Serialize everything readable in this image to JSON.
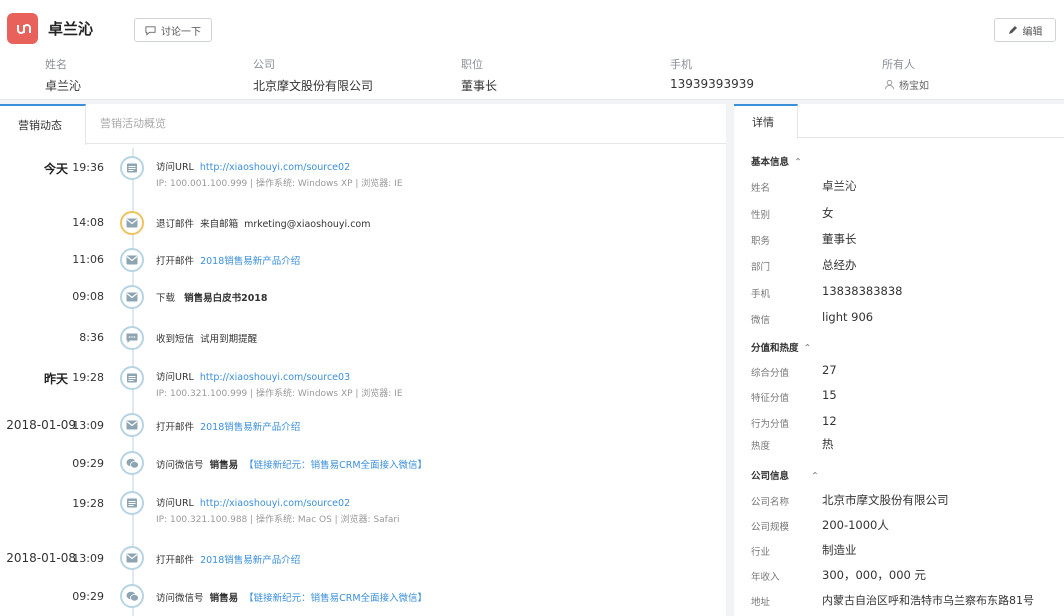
{
  "header": {
    "name": "卓兰沁",
    "discuss_label": "讨论一下",
    "edit_label": "编辑",
    "fields": [
      {
        "label": "姓名",
        "value": "卓兰沁"
      },
      {
        "label": "公司",
        "value": "北京摩文股份有限公司"
      },
      {
        "label": "职位",
        "value": "董事长"
      },
      {
        "label": "手机",
        "value": "13939393939"
      },
      {
        "label": "所有人",
        "value": "杨宝如"
      }
    ]
  },
  "tabs": {
    "active": "营销动态",
    "inactive": "营销活动概览"
  },
  "timeline": [
    {
      "date": "今天",
      "time": "19:36",
      "icon": "web-page-icon",
      "action": "访问URL",
      "link": "http://xiaoshouyi.com/source02",
      "detail": "IP: 100.001.100.999 | 操作系统: Windows XP | 浏览器: IE"
    },
    {
      "date": "",
      "time": "14:08",
      "icon": "mail-icon",
      "action": "退订邮件",
      "extra": "来自邮箱",
      "text": "mrketing@xiaoshouyi.com"
    },
    {
      "date": "",
      "time": "11:06",
      "icon": "mail-icon",
      "action": "打开邮件",
      "link": "2018销售易新产品介绍"
    },
    {
      "date": "",
      "time": "09:08",
      "icon": "mail-icon",
      "action": "下载",
      "bold": "销售易白皮书2018"
    },
    {
      "date": "",
      "time": "8:36",
      "icon": "sms-icon",
      "action": "收到短信",
      "text": "试用到期提醒"
    },
    {
      "date": "昨天",
      "time": "19:28",
      "icon": "web-page-icon",
      "action": "访问URL",
      "link": "http://xiaoshouyi.com/source03",
      "detail": "IP: 100.321.100.999 | 操作系统: Windows XP | 浏览器: IE"
    },
    {
      "date": "2018-01-09",
      "time": "13:09",
      "icon": "mail-icon",
      "action": "打开邮件",
      "link": "2018销售易新产品介绍"
    },
    {
      "date": "",
      "time": "09:29",
      "icon": "wechat-icon",
      "action": "访问微信号",
      "bold": "销售易",
      "link": "【链接新纪元：销售易CRM全面接入微信】"
    },
    {
      "date": "",
      "time": "19:28",
      "icon": "web-page-icon",
      "action": "访问URL",
      "link": "http://xiaoshouyi.com/source02",
      "detail": "IP: 100.321.100.988 | 操作系统: Mac OS | 浏览器: Safari"
    },
    {
      "date": "2018-01-08",
      "time": "13:09",
      "icon": "mail-icon",
      "action": "打开邮件",
      "link": "2018销售易新产品介绍"
    },
    {
      "date": "",
      "time": "09:29",
      "icon": "wechat-icon",
      "action": "访问微信号",
      "bold": "销售易",
      "link": "【链接新纪元：销售易CRM全面接入微信】"
    }
  ],
  "details": {
    "tab": "详情",
    "sections": [
      {
        "title": "基本信息",
        "rows": [
          {
            "k": "姓名",
            "v": "卓兰沁"
          },
          {
            "k": "性别",
            "v": "女"
          },
          {
            "k": "职务",
            "v": "董事长"
          },
          {
            "k": "部门",
            "v": "总经办"
          },
          {
            "k": "手机",
            "v": "13838383838"
          },
          {
            "k": "微信",
            "v": "light 906"
          }
        ]
      },
      {
        "title": "分值和热度",
        "rows": [
          {
            "k": "综合分值",
            "v": "27"
          },
          {
            "k": "特征分值",
            "v": "15"
          },
          {
            "k": "行为分值",
            "v": "12"
          },
          {
            "k": "热度",
            "v": "热"
          }
        ]
      },
      {
        "title": "公司信息",
        "rows": [
          {
            "k": "公司名称",
            "v": "北京市摩文股份有限公司"
          },
          {
            "k": "公司规模",
            "v": "200-1000人"
          },
          {
            "k": "行业",
            "v": "制造业"
          },
          {
            "k": "年收入",
            "v": "300，000，000 元"
          },
          {
            "k": "地址",
            "v": "内蒙古自治区呼和浩特市乌兰察布东路81号"
          }
        ]
      }
    ]
  },
  "colors": {
    "accent": "#3b8fd8",
    "logo": "#e8615a",
    "link": "#3b8fd8"
  }
}
